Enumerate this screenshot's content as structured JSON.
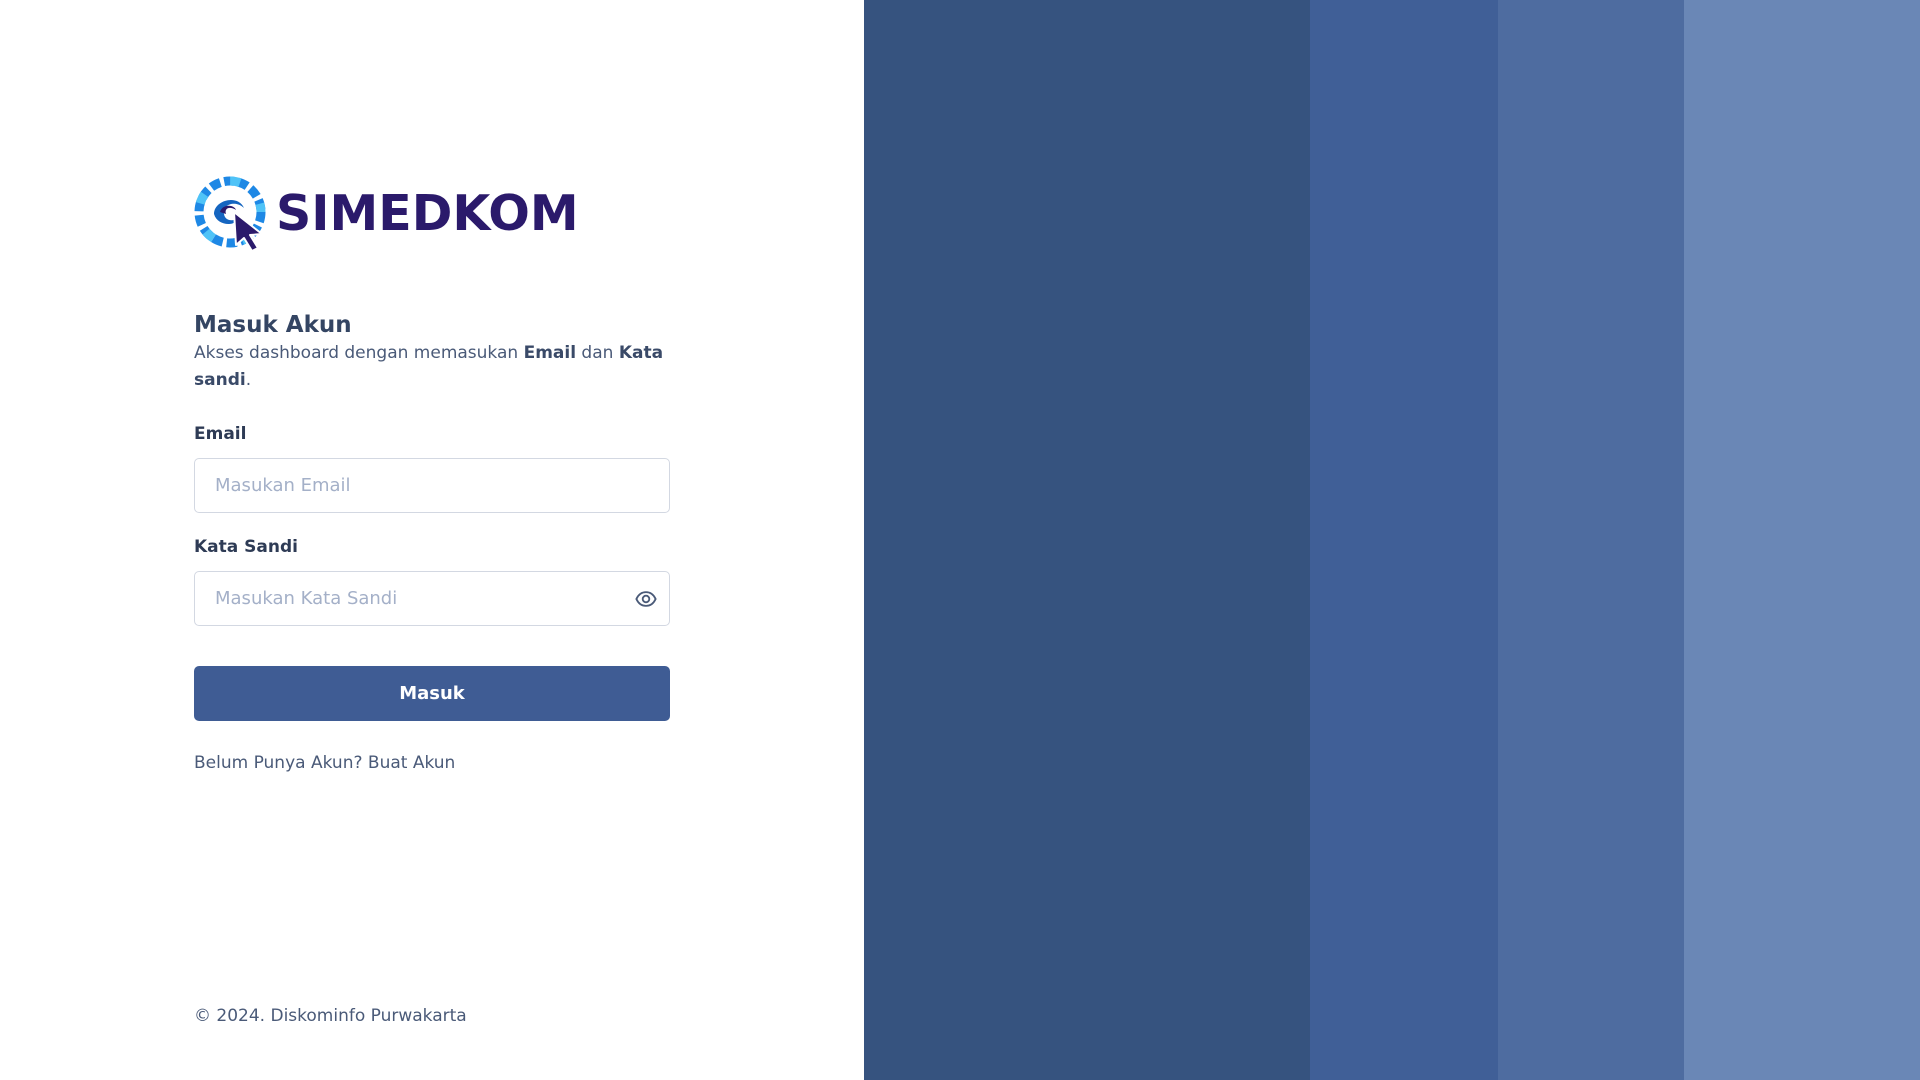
{
  "brand": {
    "name": "SIMEDKOM"
  },
  "login": {
    "title": "Masuk Akun",
    "subtitle_prefix": "Akses dashboard dengan memasukan ",
    "subtitle_email": "Email",
    "subtitle_and": " dan ",
    "subtitle_password": "Kata sandi",
    "subtitle_suffix": ".",
    "email_label": "Email",
    "email_placeholder": "Masukan Email",
    "email_value": "",
    "password_label": "Kata Sandi",
    "password_placeholder": "Masukan Kata Sandi",
    "password_value": "",
    "submit_label": "Masuk",
    "register_prompt": "Belum Punya Akun? ",
    "register_link": "Buat Akun"
  },
  "footer": {
    "copyright": "© 2024. Diskominfo Purwakarta"
  },
  "icons": {
    "logo": "globe-cursor-logo-icon",
    "password_toggle": "eye-icon"
  },
  "colors": {
    "primary": "#3f5c94",
    "brand_text": "#2b1a6b",
    "stripe_1": "#36537f",
    "stripe_2": "#405f97",
    "stripe_3": "#4e6ca0",
    "stripe_4": "#6a87b6"
  }
}
